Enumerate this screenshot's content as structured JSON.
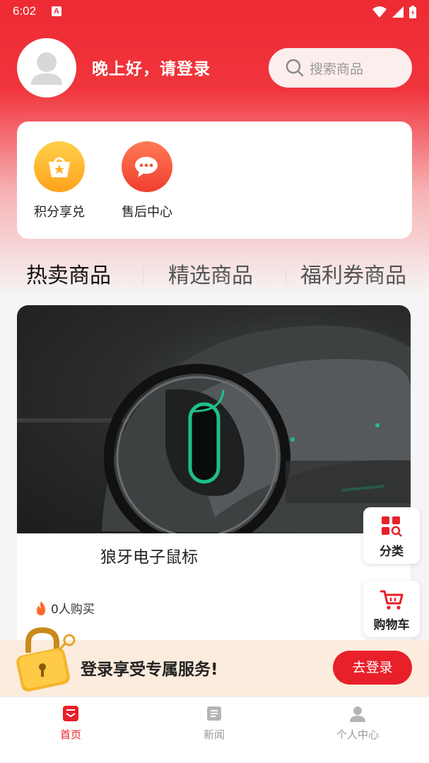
{
  "status_bar": {
    "time": "6:02",
    "notification_badge": "A"
  },
  "header": {
    "greeting": "晚上好，请登录",
    "search_placeholder": "搜索商品"
  },
  "quick_actions": [
    {
      "label": "积分享兑",
      "icon": "basket-star-icon"
    },
    {
      "label": "售后中心",
      "icon": "chat-bubble-icon"
    }
  ],
  "tabs": [
    {
      "label": "热卖商品",
      "active": true
    },
    {
      "label": "精选商品",
      "active": false
    },
    {
      "label": "福利券商品",
      "active": false
    }
  ],
  "product": {
    "name": "狼牙电子鼠标",
    "sales": "0人购买",
    "image": "gaming-mouse-image"
  },
  "float_buttons": {
    "category_label": "分类",
    "cart_label": "购物车"
  },
  "login_banner": {
    "text": "登录享受专属服务!",
    "button_label": "去登录"
  },
  "bottom_nav": [
    {
      "label": "首页",
      "active": true,
      "icon": "home-icon"
    },
    {
      "label": "新闻",
      "active": false,
      "icon": "news-icon"
    },
    {
      "label": "个人中心",
      "active": false,
      "icon": "user-icon"
    }
  ],
  "colors": {
    "accent": "#e8202a",
    "header_red": "#ee2a33",
    "banner_bg": "#fcecdd"
  }
}
